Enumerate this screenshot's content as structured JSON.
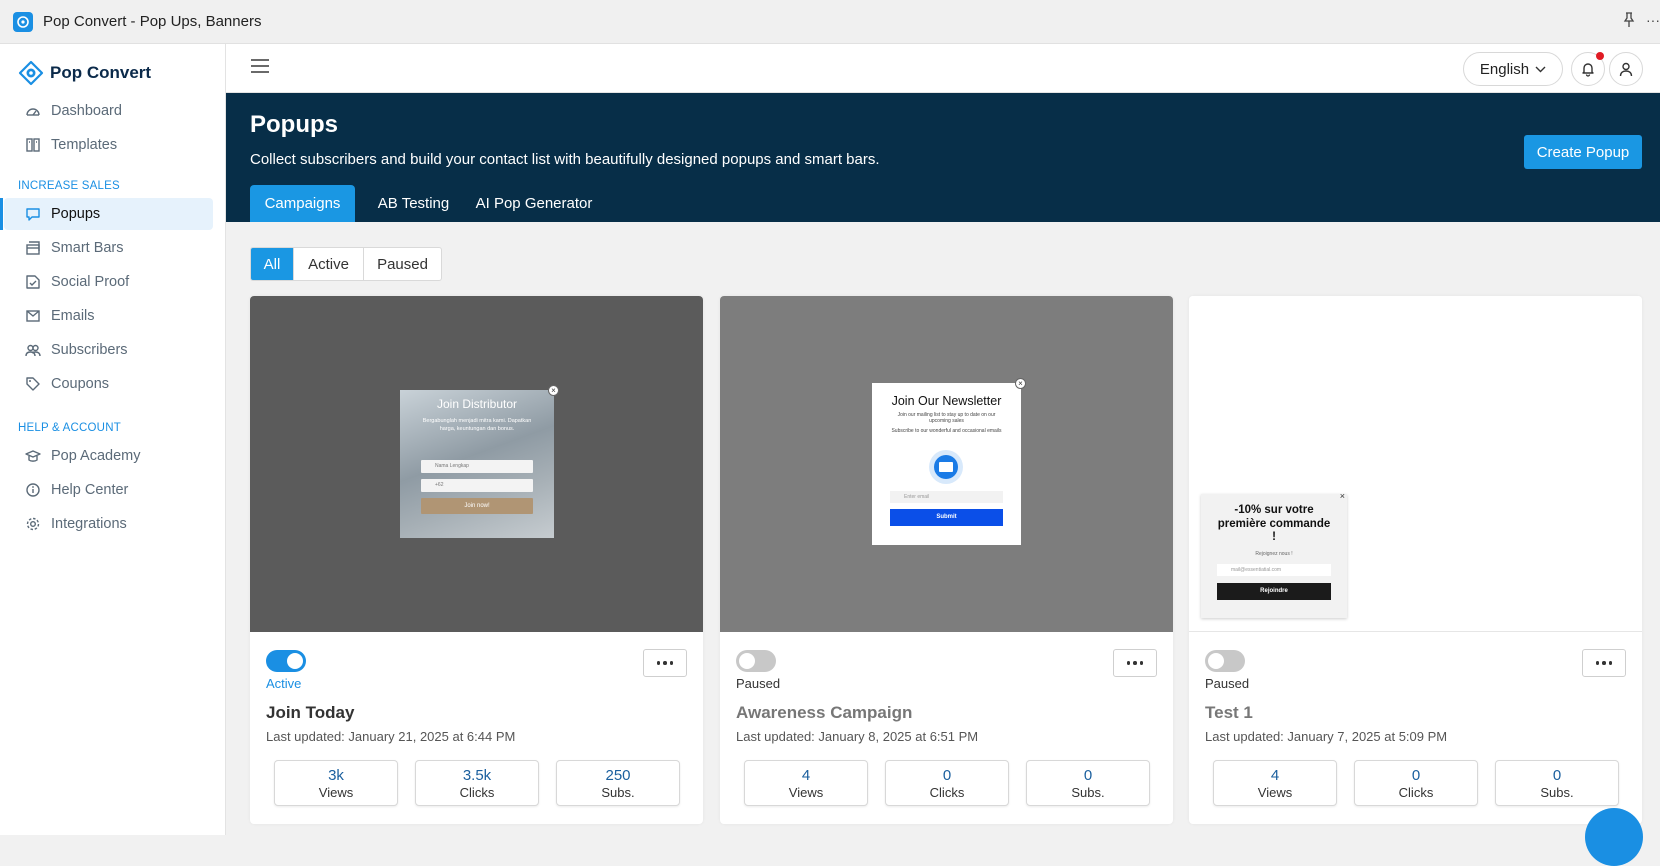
{
  "window": {
    "title": "Pop Convert - Pop Ups, Banners",
    "pin_icon": "pin-icon",
    "more_icon": "ellipsis-icon"
  },
  "sidebar": {
    "logo": "Pop Convert",
    "items_top": [
      {
        "label": "Dashboard",
        "icon": "dashboard-icon"
      },
      {
        "label": "Templates",
        "icon": "templates-icon"
      }
    ],
    "section_sales": "INCREASE SALES",
    "items_sales": [
      {
        "label": "Popups",
        "icon": "popup-icon",
        "active": true
      },
      {
        "label": "Smart Bars",
        "icon": "smart-bar-icon"
      },
      {
        "label": "Social Proof",
        "icon": "social-proof-icon"
      },
      {
        "label": "Emails",
        "icon": "email-icon"
      },
      {
        "label": "Subscribers",
        "icon": "subscribers-icon"
      },
      {
        "label": "Coupons",
        "icon": "coupon-icon"
      }
    ],
    "section_help": "HELP & ACCOUNT",
    "items_help": [
      {
        "label": "Pop Academy",
        "icon": "academy-icon"
      },
      {
        "label": "Help Center",
        "icon": "help-icon"
      },
      {
        "label": "Integrations",
        "icon": "integrations-icon"
      }
    ]
  },
  "topbar": {
    "language": "English"
  },
  "header": {
    "title": "Popups",
    "subtitle": "Collect subscribers and build your contact list with beautifully designed popups and smart bars.",
    "create_button": "Create Popup",
    "tabs": [
      "Campaigns",
      "AB Testing",
      "AI Pop Generator"
    ]
  },
  "filters": [
    "All",
    "Active",
    "Paused"
  ],
  "cards": [
    {
      "name": "Join Today",
      "status": "Active",
      "enabled": true,
      "updated": "Last updated: January 21, 2025 at 6:44 PM",
      "stats": [
        {
          "value": "3k",
          "label": "Views"
        },
        {
          "value": "3.5k",
          "label": "Clicks"
        },
        {
          "value": "250",
          "label": "Subs."
        }
      ],
      "preview": {
        "heading": "Join Distributor",
        "text": "Bergabunglah menjadi mitra kami. Dapatkan harga, keuntungan dan bonus.",
        "field1": "Nama Lengkap",
        "field2": "+62",
        "button": "Join now!"
      }
    },
    {
      "name": "Awareness Campaign",
      "status": "Paused",
      "enabled": false,
      "updated": "Last updated: January 8, 2025 at 6:51 PM",
      "stats": [
        {
          "value": "4",
          "label": "Views"
        },
        {
          "value": "0",
          "label": "Clicks"
        },
        {
          "value": "0",
          "label": "Subs."
        }
      ],
      "preview": {
        "heading": "Join Our Newsletter",
        "text": "Join our mailing list to stay up to date on our upcoming sales",
        "text2": "Subscribe to our wonderful and occasional emails",
        "field1": "Enter email",
        "button": "Submit"
      }
    },
    {
      "name": "Test 1",
      "status": "Paused",
      "enabled": false,
      "updated": "Last updated: January 7, 2025 at 5:09 PM",
      "stats": [
        {
          "value": "4",
          "label": "Views"
        },
        {
          "value": "0",
          "label": "Clicks"
        },
        {
          "value": "0",
          "label": "Subs."
        }
      ],
      "preview": {
        "heading": "-10% sur votre première commande !",
        "text": "Rejoignez nous !",
        "field1": "mail@essentiatial.com",
        "button": "Rejoindre"
      }
    }
  ],
  "colors": {
    "accent": "#1a97e3",
    "hero_bg": "#072e48",
    "active_status": "#1a8fe3"
  }
}
